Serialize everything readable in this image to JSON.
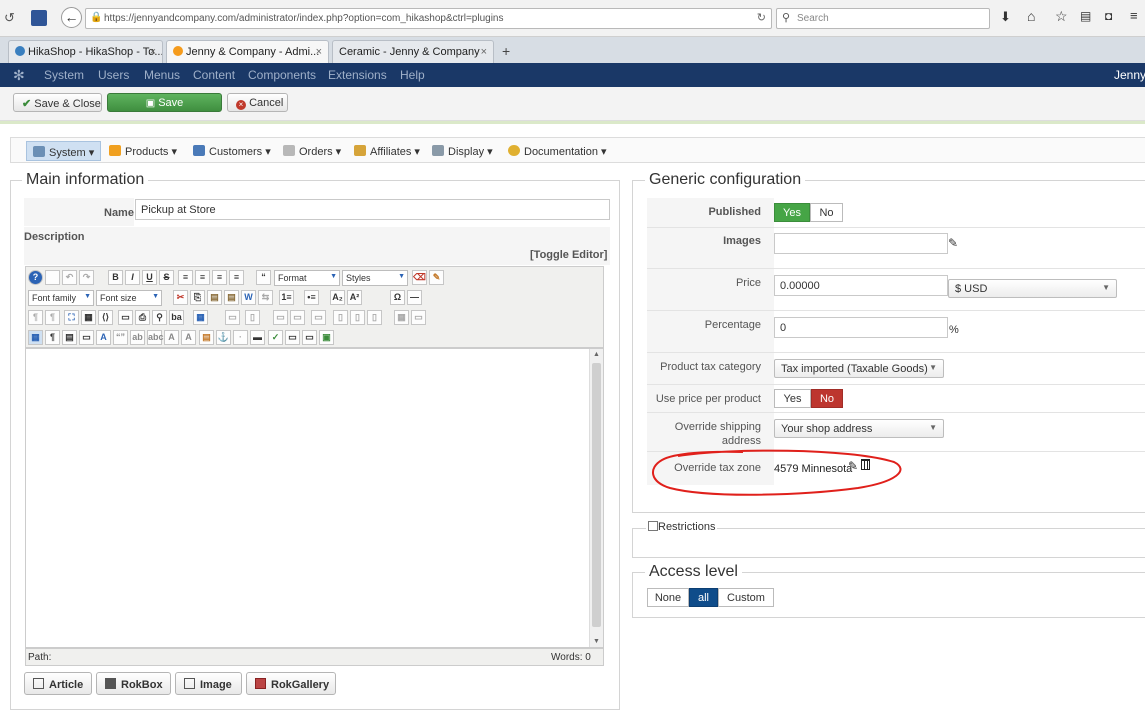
{
  "browser": {
    "url": "https://jennyandcompany.com/administrator/index.php?option=com_hikashop&ctrl=plugins",
    "search_placeholder": "Search",
    "tabs": [
      {
        "label": "HikaShop - HikaShop - To..."
      },
      {
        "label": "Jenny & Company - Admi..."
      },
      {
        "label": "Ceramic - Jenny & Company"
      }
    ],
    "new_tab": "+",
    "close_glyph": "×"
  },
  "joomla_menu": {
    "items": [
      "System",
      "Users",
      "Menus",
      "Content",
      "Components",
      "Extensions",
      "Help"
    ],
    "site_name": "Jenny"
  },
  "toolbar": {
    "save_close": "Save & Close",
    "save": "Save",
    "cancel": "Cancel"
  },
  "hikashop_menu": {
    "items": [
      "System",
      "Products",
      "Customers",
      "Orders",
      "Affiliates",
      "Display",
      "Documentation"
    ]
  },
  "main_info": {
    "legend": "Main information",
    "name_label": "Name",
    "name_value": "Pickup at Store",
    "description_label": "Description",
    "toggle_editor": "[Toggle Editor]",
    "format_select": "Format",
    "styles_select": "Styles",
    "font_family_select": "Font family",
    "font_size_select": "Font size",
    "path_label": "Path:",
    "words_label": "Words: 0",
    "editor_buttons": [
      "Article",
      "RokBox",
      "Image",
      "RokGallery"
    ]
  },
  "generic": {
    "legend": "Generic configuration",
    "published_label": "Published",
    "published_yes": "Yes",
    "published_no": "No",
    "images_label": "Images",
    "images_value": "",
    "price_label": "Price",
    "price_value": "0.00000",
    "currency": "$ USD",
    "percentage_label": "Percentage",
    "percentage_value": "0",
    "percentage_sign": "%",
    "tax_category_label": "Product tax category",
    "tax_category_value": "Tax imported (Taxable Goods)",
    "price_per_product_label": "Use price per product",
    "price_per_product_yes": "Yes",
    "price_per_product_no": "No",
    "override_shipping_label": "Override shipping address",
    "override_shipping_value": "Your shop address",
    "override_tax_label": "Override tax zone",
    "override_tax_value": "4579 Minnesota"
  },
  "restrictions": {
    "legend": "Restrictions"
  },
  "access_level": {
    "legend": "Access level",
    "options": [
      "None",
      "all",
      "Custom"
    ]
  },
  "colors": {
    "joomla_nav": "#1a3867",
    "save_green": "#46a546",
    "no_red": "#bd362f",
    "all_blue": "#0f4c8a",
    "annotation_red": "#e0201b"
  }
}
